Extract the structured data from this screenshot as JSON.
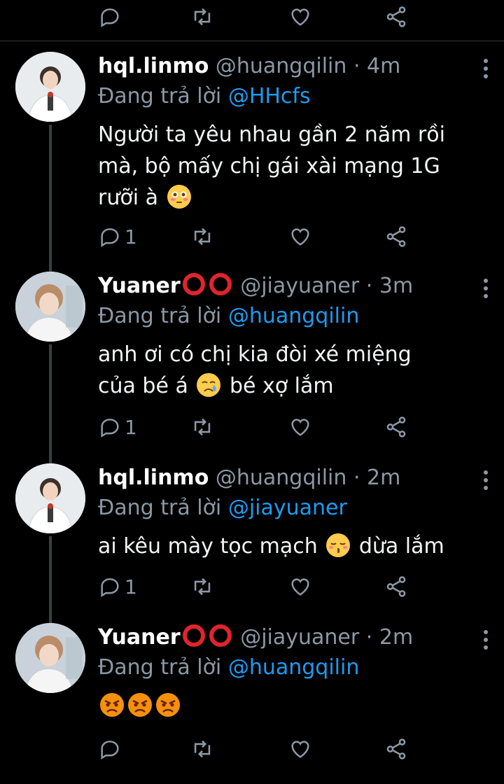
{
  "tweets": [
    {
      "name": "hql.linmo",
      "handle": "@huangqilin",
      "dot": "·",
      "time": "4m",
      "reply_prefix": "Đang trả lời",
      "reply_to": "@HHcfs",
      "text_lines": [
        "Người ta yêu nhau gần 2 năm rồi",
        "mà, bộ mấy chị gái xài mạng 1G",
        "rưỡi à"
      ],
      "emoji_names": [
        "flushed-face-emoji"
      ],
      "reply_count": "1",
      "name_badge": ""
    },
    {
      "name": "Yuaner",
      "handle": "@jiayuaner",
      "dot": "·",
      "time": "3m",
      "reply_prefix": "Đang trả lời",
      "reply_to": "@huangqilin",
      "text_lines": [
        "anh ơi có chị kia đòi xé miệng",
        "của bé á",
        "bé xợ lắm"
      ],
      "emoji_names": [
        "crying-face-emoji"
      ],
      "reply_count": "1",
      "name_badge": "two-red-circles-icon"
    },
    {
      "name": "hql.linmo",
      "handle": "@huangqilin",
      "dot": "·",
      "time": "2m",
      "reply_prefix": "Đang trả lời",
      "reply_to": "@jiayuaner",
      "text_lines": [
        "ai kêu mày tọc mạch",
        "dừa lắm"
      ],
      "emoji_names": [
        "kissing-closed-eyes-emoji"
      ],
      "reply_count": "1",
      "name_badge": ""
    },
    {
      "name": "Yuaner",
      "handle": "@jiayuaner",
      "dot": "·",
      "time": "2m",
      "reply_prefix": "Đang trả lời",
      "reply_to": "@huangqilin",
      "text_lines": [],
      "emoji_names": [
        "pouting-face-emoji",
        "pouting-face-emoji",
        "pouting-face-emoji"
      ],
      "reply_count": "",
      "name_badge": "two-red-circles-icon"
    }
  ],
  "icons": {
    "reply": "reply-icon",
    "retweet": "retweet-icon",
    "like": "heart-icon",
    "share": "share-icon",
    "more": "more-vertical-icon"
  },
  "colors": {
    "background": "#000000",
    "primary_text": "#e7e9ea",
    "secondary_text": "#8b98a5",
    "link": "#1d9bf0",
    "badge_red": "#e0242c",
    "thread_line": "#3b3f42"
  }
}
